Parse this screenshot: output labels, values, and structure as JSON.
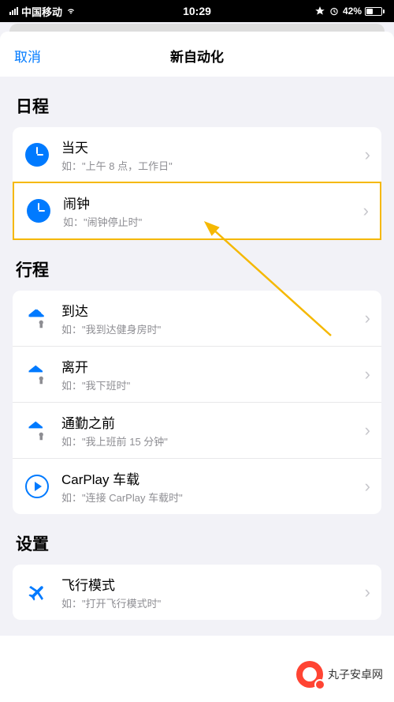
{
  "status": {
    "carrier": "中国移动",
    "time": "10:29",
    "battery": "42%"
  },
  "nav": {
    "cancel": "取消",
    "title": "新自动化"
  },
  "sections": {
    "schedule": {
      "title": "日程",
      "items": [
        {
          "title": "当天",
          "sub": "如：\"上午 8 点，工作日\"",
          "icon": "clock"
        },
        {
          "title": "闹钟",
          "sub": "如：\"闹钟停止时\"",
          "icon": "clock",
          "highlighted": true
        }
      ]
    },
    "travel": {
      "title": "行程",
      "items": [
        {
          "title": "到达",
          "sub": "如：\"我到达健身房时\"",
          "icon": "house"
        },
        {
          "title": "离开",
          "sub": "如：\"我下班时\"",
          "icon": "house"
        },
        {
          "title": "通勤之前",
          "sub": "如：\"我上班前 15 分钟\"",
          "icon": "house"
        },
        {
          "title": "CarPlay 车载",
          "sub": "如：\"连接 CarPlay 车载时\"",
          "icon": "carplay"
        }
      ]
    },
    "settings": {
      "title": "设置",
      "items": [
        {
          "title": "飞行模式",
          "sub": "如：\"打开飞行模式时\"",
          "icon": "plane"
        }
      ]
    }
  },
  "watermark": "丸子安卓网"
}
